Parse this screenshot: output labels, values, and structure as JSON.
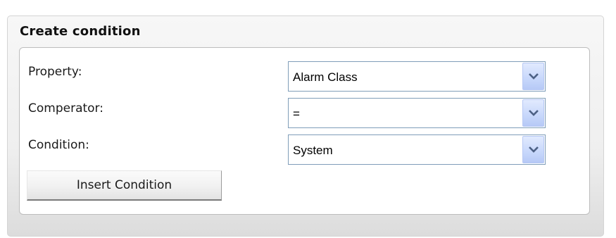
{
  "panel": {
    "title": "Create condition"
  },
  "form": {
    "fields": [
      {
        "label": "Property:",
        "value": "Alarm Class"
      },
      {
        "label": "Comperator:",
        "value": "="
      },
      {
        "label": "Condition:",
        "value": "System"
      }
    ],
    "insert_label": "Insert Condition"
  },
  "icons": {
    "dropdown": "chevron-down-icon"
  },
  "colors": {
    "dropdown_button": "#c7d7fb",
    "dropdown_arrow": "#4d6185",
    "select_border": "#7f9db9"
  }
}
